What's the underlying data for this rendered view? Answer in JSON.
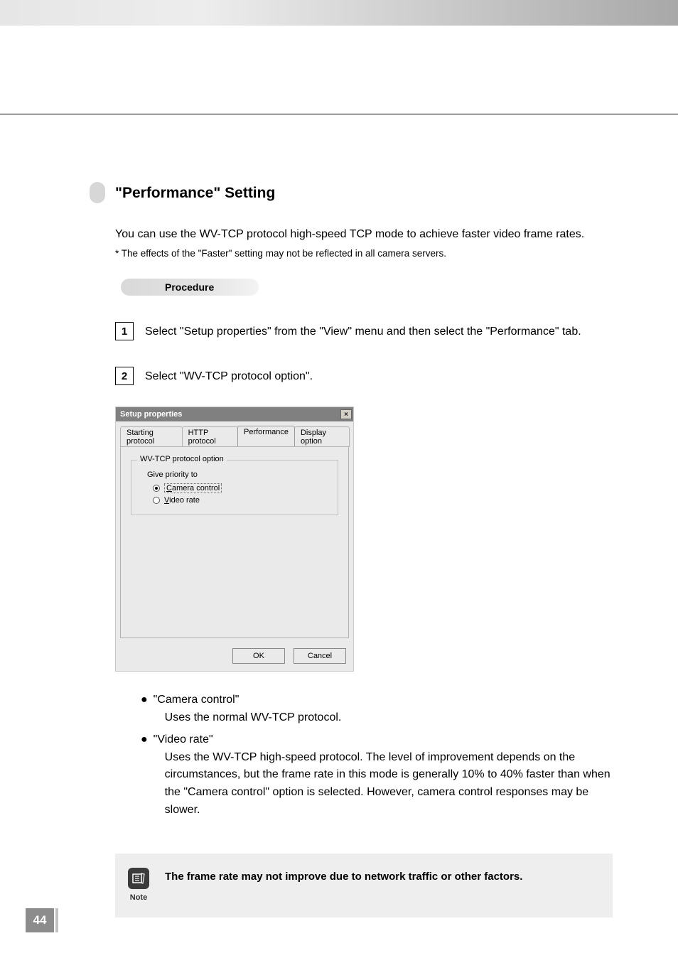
{
  "heading": "\"Performance\" Setting",
  "intro": "You can use the WV-TCP protocol high-speed TCP mode to achieve faster video frame rates.",
  "footnote": "* The effects of the \"Faster\" setting may not be reflected in all camera servers.",
  "procedure_label": "Procedure",
  "steps": [
    {
      "num": "1",
      "text": "Select \"Setup properties\" from the \"View\" menu and then select the \"Performance\" tab."
    },
    {
      "num": "2",
      "text": "Select \"WV-TCP protocol option\"."
    }
  ],
  "dialog": {
    "title": "Setup properties",
    "close": "×",
    "tabs": [
      "Starting protocol",
      "HTTP protocol",
      "Performance",
      "Display option"
    ],
    "active_tab": 2,
    "groupbox_legend": "WV-TCP protocol option",
    "priority_label": "Give priority to",
    "radio_camera": "Camera control",
    "radio_camera_accel": "C",
    "radio_video": "Video rate",
    "radio_video_accel": "V",
    "ok": "OK",
    "cancel": "Cancel"
  },
  "explain": [
    {
      "title": "\"Camera control\"",
      "text": "Uses the normal WV-TCP protocol."
    },
    {
      "title": "\"Video rate\"",
      "text": "Uses the WV-TCP high-speed protocol. The level of improvement depends on the circumstances, but the frame rate in this mode is generally 10% to 40% faster than when the \"Camera control\" option is selected. However, camera control responses may be slower."
    }
  ],
  "note": {
    "label": "Note",
    "text": "The frame rate may not improve due to network traffic or other factors."
  },
  "page_number": "44"
}
